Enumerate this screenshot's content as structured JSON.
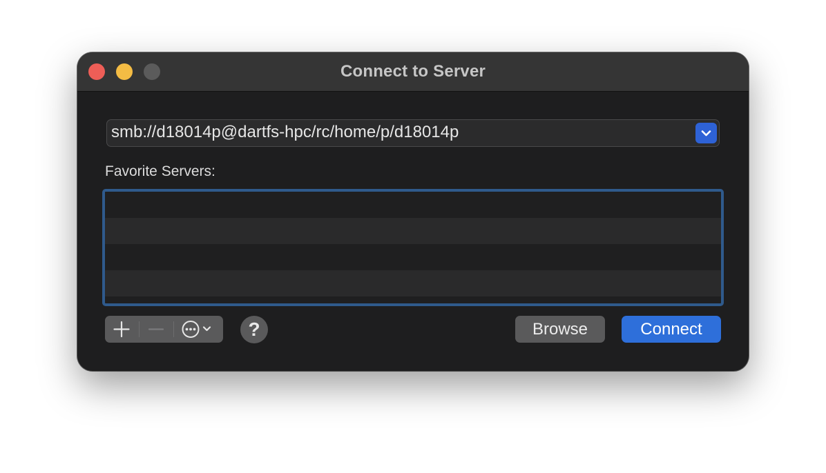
{
  "window": {
    "title": "Connect to Server"
  },
  "address": {
    "value": "smb://d18014p@dartfs-hpc/rc/home/p/d18014p",
    "dropdown_icon": "chevron-down-icon"
  },
  "favorites": {
    "label": "Favorite Servers:",
    "items": []
  },
  "toolbar": {
    "add_icon": "plus-icon",
    "remove_icon": "minus-icon",
    "more_icon": "ellipsis-circle-icon",
    "help_label": "?"
  },
  "buttons": {
    "browse_label": "Browse",
    "connect_label": "Connect"
  },
  "colors": {
    "accent": "#2e6fda",
    "list_focus_ring": "#2f5a8c",
    "close": "#ee5e57",
    "minimize": "#f4bc44",
    "zoom_disabled": "#5b5b5b"
  }
}
